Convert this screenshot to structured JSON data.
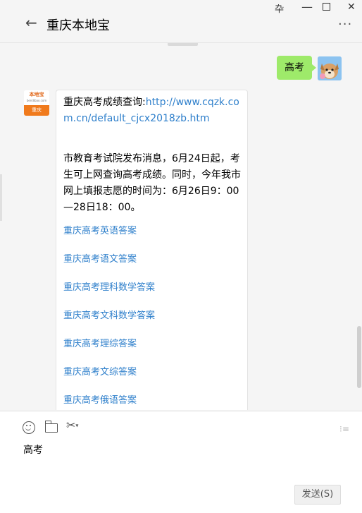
{
  "window": {
    "pin_glyph": "卆",
    "minimize_glyph": "—",
    "close_glyph": "✕"
  },
  "header": {
    "back_glyph": "←",
    "title": "重庆本地宝",
    "more_glyph": "···"
  },
  "chat": {
    "my_message": "高考",
    "their_avatar": {
      "top_text": "本地宝",
      "url_text": "bendibao.com",
      "bottom_text": "重庆"
    },
    "their_message": {
      "intro_prefix": "重庆高考成绩查询:",
      "intro_link": "http://www.cqzk.com.cn/default_cjcx2018zb.htm",
      "body": "市教育考试院发布消息，6月24日起，考生可上网查询高考成绩。同时，今年我市网上填报志愿的时间为：6月26日9：00—28日18：00。",
      "links": [
        "重庆高考英语答案",
        "重庆高考语文答案",
        "重庆高考理科数学答案",
        "重庆高考文科数学答案",
        "重庆高考理综答案",
        "重庆高考文综答案",
        "重庆高考俄语答案"
      ]
    }
  },
  "composer": {
    "input_value": "高考",
    "send_label": "发送(S)",
    "tools": [
      "emoji-icon",
      "folder-icon",
      "scissors-icon"
    ],
    "history_glyph": "⁝≡"
  },
  "colors": {
    "my_bubble": "#9eea6a",
    "link": "#2e7fcb",
    "brand_orange": "#f07a1c"
  }
}
